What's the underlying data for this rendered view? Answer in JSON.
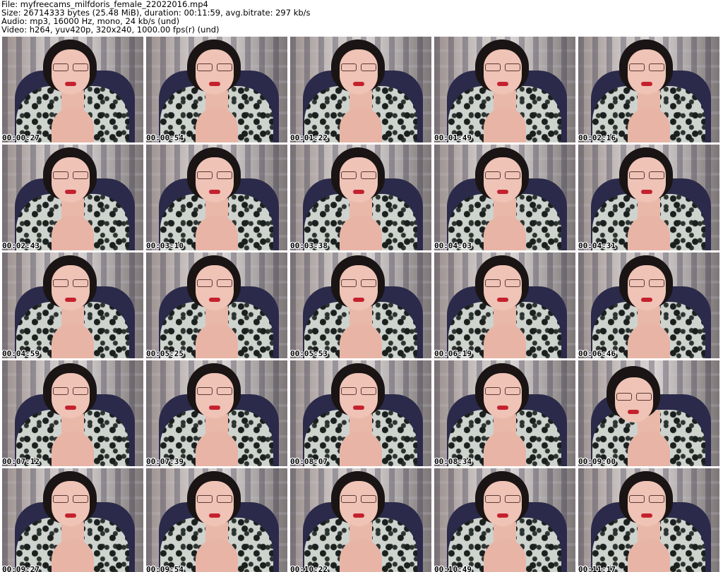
{
  "header": {
    "file_line": "File: myfreecams_milfdoris_female_22022016.mp4",
    "size_line": "Size: 26714333 bytes (25.48 MiB), duration: 00:11:59, avg.bitrate: 297 kb/s",
    "audio_line": "Audio: mp3, 16000 Hz, mono, 24 kb/s (und)",
    "video_line": "Video: h264, yuv420p, 320x240, 1000.00 fps(r) (und)"
  },
  "thumbnails": [
    {
      "timestamp": "00:00:27"
    },
    {
      "timestamp": "00:00:54"
    },
    {
      "timestamp": "00:01:22"
    },
    {
      "timestamp": "00:01:49"
    },
    {
      "timestamp": "00:02:16"
    },
    {
      "timestamp": "00:02:43"
    },
    {
      "timestamp": "00:03:10"
    },
    {
      "timestamp": "00:03:38"
    },
    {
      "timestamp": "00:04:03"
    },
    {
      "timestamp": "00:04:31"
    },
    {
      "timestamp": "00:04:59"
    },
    {
      "timestamp": "00:05:25"
    },
    {
      "timestamp": "00:05:53"
    },
    {
      "timestamp": "00:06:19"
    },
    {
      "timestamp": "00:06:46"
    },
    {
      "timestamp": "00:07:12"
    },
    {
      "timestamp": "00:07:39"
    },
    {
      "timestamp": "00:08:07"
    },
    {
      "timestamp": "00:08:34"
    },
    {
      "timestamp": "00:09:00"
    },
    {
      "timestamp": "00:09:27"
    },
    {
      "timestamp": "00:09:54"
    },
    {
      "timestamp": "00:10:22"
    },
    {
      "timestamp": "00:10:49"
    },
    {
      "timestamp": "00:11:17"
    }
  ]
}
